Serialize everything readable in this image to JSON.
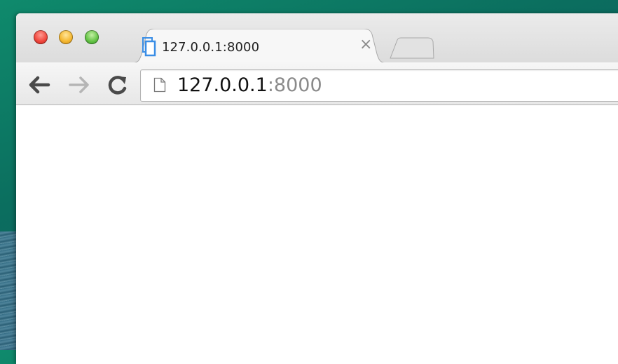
{
  "browser": {
    "tab": {
      "title": "127.0.0.1:8000",
      "close_symbol": "×",
      "favicon": "page-favicon-icon"
    },
    "new_tab": {
      "icon": "new-tab-icon"
    },
    "window_controls": [
      "close-button",
      "minimize-button",
      "zoom-button"
    ],
    "toolbar": {
      "back_icon": "back-arrow-icon",
      "forward_icon": "forward-arrow-icon",
      "reload_icon": "reload-icon"
    },
    "address_bar": {
      "page_icon": "page-icon",
      "host": "127.0.0.1",
      "port": ":8000"
    }
  },
  "colors": {
    "close": "#f0473d",
    "minimize": "#f5b72f",
    "zoom": "#64c345",
    "favicon": "#3a8ee6",
    "port_text": "#8a8a8a"
  }
}
